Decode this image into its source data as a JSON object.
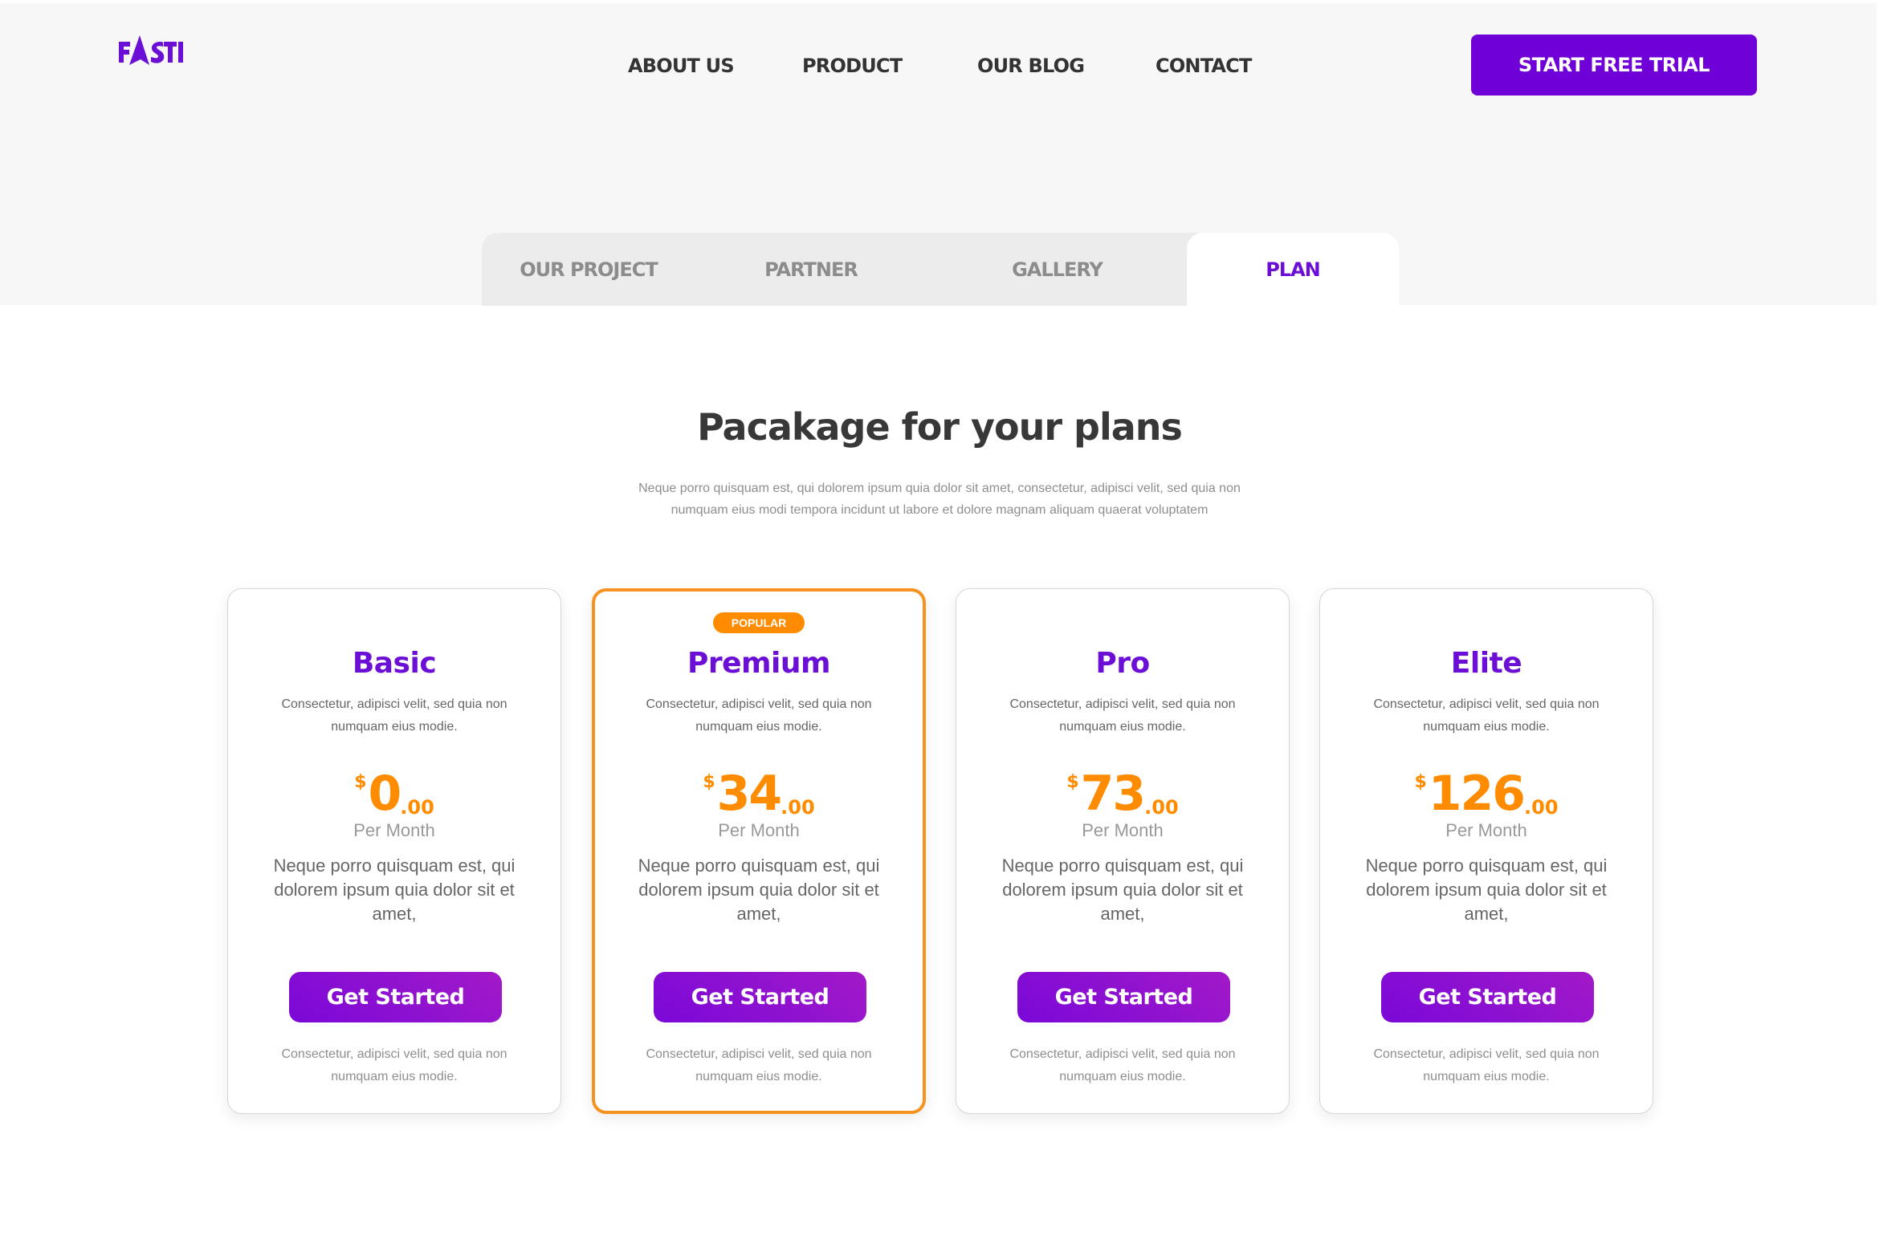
{
  "brand": {
    "name": "FASTI",
    "color": "#6c0fd6"
  },
  "nav": {
    "items": [
      {
        "label": "ABOUT US"
      },
      {
        "label": "PRODUCT"
      },
      {
        "label": "OUR BLOG"
      },
      {
        "label": "CONTACT"
      }
    ],
    "cta_label": "START FREE TRIAL"
  },
  "tabs": {
    "items": [
      {
        "label": "OUR PROJECT",
        "active": false
      },
      {
        "label": "PARTNER",
        "active": false
      },
      {
        "label": "GALLERY",
        "active": false
      },
      {
        "label": "PLAN",
        "active": true
      }
    ]
  },
  "section": {
    "title": "Pacakage for your plans",
    "subtitle": "Neque porro quisquam est, qui dolorem ipsum quia dolor sit amet, consectetur, adipisci velit, sed quia non numquam eius modi tempora incidunt ut labore et dolore magnam aliquam quaerat voluptatem"
  },
  "plans": [
    {
      "name": "Basic",
      "popular": false,
      "description": "Consectetur, adipisci velit, sed quia non numquam eius modie.",
      "currency": "$",
      "price": "0",
      "cents": ".00",
      "period": "Per Month",
      "body": "Neque porro quisquam est, qui dolorem ipsum quia dolor sit et amet,",
      "button_label": "Get Started",
      "footer": "Consectetur, adipisci velit, sed quia non numquam eius modie."
    },
    {
      "name": "Premium",
      "popular": true,
      "badge": "POPULAR",
      "description": "Consectetur, adipisci velit, sed quia non numquam eius modie.",
      "currency": "$",
      "price": "34",
      "cents": ".00",
      "period": "Per Month",
      "body": "Neque porro quisquam est, qui dolorem ipsum quia dolor sit et amet,",
      "button_label": "Get Started",
      "footer": "Consectetur, adipisci velit, sed quia non numquam eius modie."
    },
    {
      "name": "Pro",
      "popular": false,
      "description": "Consectetur, adipisci velit, sed quia non numquam eius modie.",
      "currency": "$",
      "price": "73",
      "cents": ".00",
      "period": "Per Month",
      "body": "Neque porro quisquam est, qui dolorem ipsum quia dolor sit et amet,",
      "button_label": "Get Started",
      "footer": "Consectetur, adipisci velit, sed quia non numquam eius modie."
    },
    {
      "name": "Elite",
      "popular": false,
      "description": "Consectetur, adipisci velit, sed quia non numquam eius modie.",
      "currency": "$",
      "price": "126",
      "cents": ".00",
      "period": "Per Month",
      "body": "Neque porro quisquam est, qui dolorem ipsum quia dolor sit et amet,",
      "button_label": "Get Started",
      "footer": "Consectetur, adipisci velit, sed quia non numquam eius modie."
    }
  ],
  "colors": {
    "primary": "#7000d8",
    "accent": "#ff8c00",
    "popular_border": "#f59220",
    "text_dark": "#383838",
    "header_bg": "#f7f7f7",
    "tab_bg": "#ececec"
  }
}
